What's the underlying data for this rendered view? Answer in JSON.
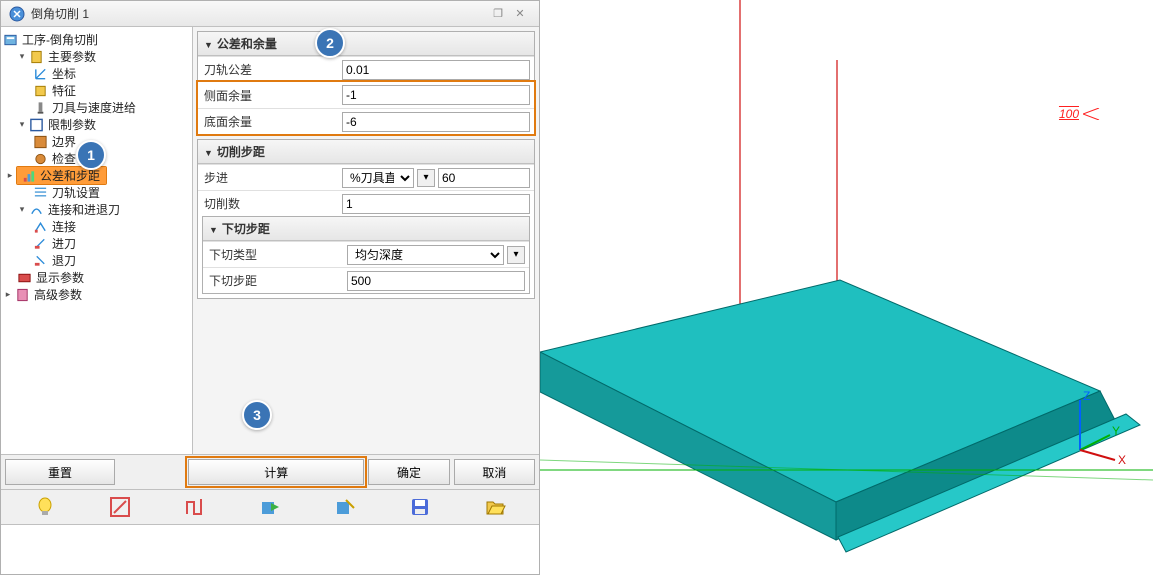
{
  "window": {
    "title": "倒角切削 1"
  },
  "tree": {
    "root": "工序-倒角切削",
    "main_params": "主要参数",
    "coord": "坐标",
    "feature": "特征",
    "tool_speed": "刀具与速度进给",
    "limit_params": "限制参数",
    "boundary": "边界",
    "check": "检查",
    "tol_step": "公差和步距",
    "toolpath_set": "刀轨设置",
    "connect_group": "连接和进退刀",
    "connect": "连接",
    "leadin": "进刀",
    "leadout": "退刀",
    "display_params": "显示参数",
    "adv_params": "高级参数"
  },
  "sections": {
    "tol_margin": "公差和余量",
    "cut_step": "切削步距",
    "down_step": "下切步距"
  },
  "fields": {
    "toolpath_tol_label": "刀轨公差",
    "toolpath_tol_value": "0.01",
    "side_margin_label": "侧面余量",
    "side_margin_value": "-1",
    "bottom_margin_label": "底面余量",
    "bottom_margin_value": "-6",
    "step_label": "步进",
    "step_type": "%刀具直径",
    "step_value": "60",
    "cut_count_label": "切削数",
    "cut_count_value": "1",
    "down_type_label": "下切类型",
    "down_type_value": "均匀深度",
    "down_step_label": "下切步距",
    "down_step_value": "500"
  },
  "buttons": {
    "reset": "重置",
    "calc": "计算",
    "ok": "确定",
    "cancel": "取消"
  },
  "callouts": {
    "c1": "1",
    "c2": "2",
    "c3": "3"
  },
  "viewport": {
    "dim": "100"
  }
}
